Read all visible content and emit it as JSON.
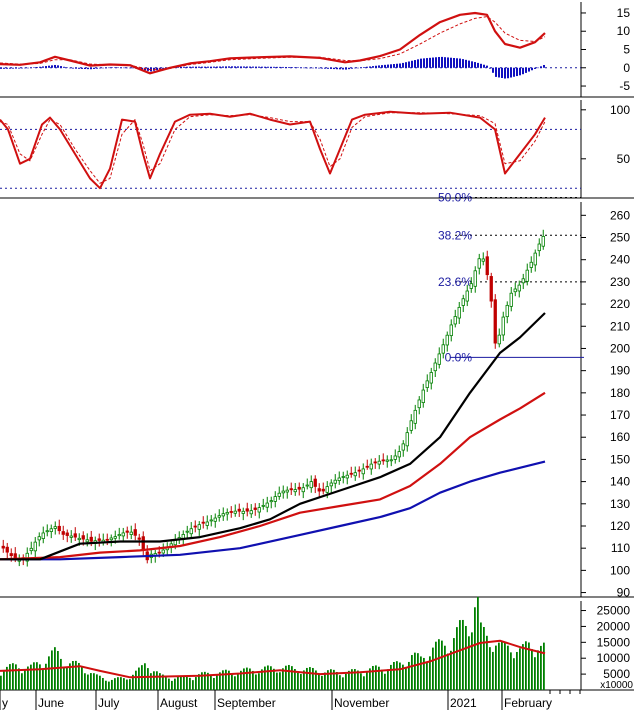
{
  "chart_data": {
    "type": "stock-technical-chart",
    "x_axis": {
      "month_labels": [
        "y",
        "June",
        "July",
        "August",
        "September",
        "November",
        "2021",
        "February"
      ]
    },
    "macd_panel": {
      "y_ticks": [
        15,
        10,
        5,
        0,
        -5
      ],
      "y_tick_labels": [
        "15",
        "10",
        "5",
        "0",
        "-5"
      ],
      "ylim": [
        -8,
        18
      ],
      "zero_line": 0,
      "macd_line": [
        [
          0,
          1
        ],
        [
          20,
          0.8
        ],
        [
          40,
          1.5
        ],
        [
          55,
          3
        ],
        [
          70,
          2
        ],
        [
          90,
          0.6
        ],
        [
          110,
          0.9
        ],
        [
          130,
          0.7
        ],
        [
          150,
          -1.5
        ],
        [
          170,
          0
        ],
        [
          190,
          1.2
        ],
        [
          210,
          1.8
        ],
        [
          230,
          2.6
        ],
        [
          260,
          2.9
        ],
        [
          290,
          3.1
        ],
        [
          320,
          2.7
        ],
        [
          345,
          1.5
        ],
        [
          360,
          2
        ],
        [
          380,
          3.2
        ],
        [
          400,
          5
        ],
        [
          420,
          9
        ],
        [
          440,
          12.5
        ],
        [
          460,
          14.5
        ],
        [
          475,
          15
        ],
        [
          487,
          14.5
        ],
        [
          495,
          10
        ],
        [
          505,
          6.5
        ],
        [
          520,
          5.5
        ],
        [
          535,
          7
        ],
        [
          545,
          9.5
        ]
      ],
      "signal_line": [
        [
          0,
          1.3
        ],
        [
          20,
          1
        ],
        [
          40,
          1.2
        ],
        [
          55,
          2.2
        ],
        [
          70,
          2.2
        ],
        [
          90,
          1
        ],
        [
          110,
          0.8
        ],
        [
          130,
          0.7
        ],
        [
          150,
          -0.5
        ],
        [
          170,
          -0.2
        ],
        [
          190,
          0.9
        ],
        [
          210,
          1.5
        ],
        [
          230,
          2.2
        ],
        [
          260,
          2.6
        ],
        [
          290,
          2.9
        ],
        [
          320,
          2.9
        ],
        [
          345,
          2
        ],
        [
          360,
          1.9
        ],
        [
          380,
          2.5
        ],
        [
          400,
          3.8
        ],
        [
          420,
          6.5
        ],
        [
          440,
          9.5
        ],
        [
          460,
          12
        ],
        [
          475,
          13.5
        ],
        [
          487,
          14
        ],
        [
          495,
          12.5
        ],
        [
          505,
          9.5
        ],
        [
          520,
          7.5
        ],
        [
          535,
          7.2
        ],
        [
          545,
          8.5
        ]
      ],
      "histogram": [
        [
          0,
          -0.3
        ],
        [
          20,
          -0.2
        ],
        [
          40,
          0.3
        ],
        [
          55,
          0.8
        ],
        [
          70,
          -0.2
        ],
        [
          90,
          -0.4
        ],
        [
          110,
          0.1
        ],
        [
          130,
          0
        ],
        [
          150,
          -1
        ],
        [
          170,
          0.2
        ],
        [
          190,
          0.3
        ],
        [
          210,
          0.3
        ],
        [
          230,
          0.4
        ],
        [
          260,
          0.3
        ],
        [
          290,
          0.2
        ],
        [
          320,
          -0.2
        ],
        [
          345,
          -0.5
        ],
        [
          360,
          0.1
        ],
        [
          380,
          0.7
        ],
        [
          400,
          1.2
        ],
        [
          420,
          2.5
        ],
        [
          440,
          3
        ],
        [
          460,
          2.5
        ],
        [
          475,
          1.5
        ],
        [
          487,
          0.5
        ],
        [
          495,
          -2.5
        ],
        [
          505,
          -3
        ],
        [
          520,
          -2
        ],
        [
          535,
          -0.2
        ],
        [
          545,
          1
        ]
      ]
    },
    "stochastic_panel": {
      "y_ticks": [
        100,
        50
      ],
      "y_tick_labels": [
        "100",
        "50"
      ],
      "ylim": [
        10,
        110
      ],
      "reference_lines": [
        80,
        20
      ],
      "k_line": [
        [
          0,
          90
        ],
        [
          8,
          80
        ],
        [
          20,
          45
        ],
        [
          30,
          50
        ],
        [
          42,
          85
        ],
        [
          50,
          92
        ],
        [
          60,
          80
        ],
        [
          75,
          55
        ],
        [
          90,
          30
        ],
        [
          100,
          20
        ],
        [
          110,
          40
        ],
        [
          122,
          90
        ],
        [
          135,
          88
        ],
        [
          143,
          55
        ],
        [
          150,
          30
        ],
        [
          160,
          55
        ],
        [
          175,
          88
        ],
        [
          190,
          95
        ],
        [
          210,
          96
        ],
        [
          230,
          93
        ],
        [
          250,
          96
        ],
        [
          270,
          90
        ],
        [
          290,
          85
        ],
        [
          310,
          88
        ],
        [
          320,
          60
        ],
        [
          330,
          35
        ],
        [
          340,
          60
        ],
        [
          352,
          90
        ],
        [
          365,
          95
        ],
        [
          390,
          98
        ],
        [
          420,
          96
        ],
        [
          450,
          97
        ],
        [
          480,
          92
        ],
        [
          495,
          80
        ],
        [
          505,
          35
        ],
        [
          520,
          55
        ],
        [
          535,
          75
        ],
        [
          545,
          92
        ]
      ],
      "d_line": [
        [
          0,
          88
        ],
        [
          8,
          85
        ],
        [
          20,
          55
        ],
        [
          30,
          48
        ],
        [
          42,
          75
        ],
        [
          50,
          90
        ],
        [
          60,
          85
        ],
        [
          75,
          60
        ],
        [
          90,
          38
        ],
        [
          100,
          25
        ],
        [
          110,
          30
        ],
        [
          122,
          75
        ],
        [
          135,
          90
        ],
        [
          143,
          65
        ],
        [
          150,
          38
        ],
        [
          160,
          45
        ],
        [
          175,
          80
        ],
        [
          190,
          93
        ],
        [
          210,
          95
        ],
        [
          230,
          94
        ],
        [
          250,
          95
        ],
        [
          270,
          92
        ],
        [
          290,
          88
        ],
        [
          310,
          88
        ],
        [
          320,
          70
        ],
        [
          330,
          42
        ],
        [
          340,
          50
        ],
        [
          352,
          82
        ],
        [
          365,
          93
        ],
        [
          390,
          97
        ],
        [
          420,
          97
        ],
        [
          450,
          96
        ],
        [
          480,
          94
        ],
        [
          495,
          86
        ],
        [
          505,
          45
        ],
        [
          520,
          48
        ],
        [
          535,
          68
        ],
        [
          545,
          88
        ]
      ]
    },
    "price_panel": {
      "y_ticks": [
        260,
        250,
        240,
        230,
        220,
        210,
        200,
        190,
        180,
        170,
        160,
        150,
        140,
        130,
        120,
        110,
        100,
        90
      ],
      "y_tick_labels": [
        "260",
        "250",
        "240",
        "230",
        "220",
        "210",
        "200",
        "190",
        "180",
        "170",
        "160",
        "150",
        "140",
        "130",
        "120",
        "110",
        "100",
        "90"
      ],
      "ylim": [
        88,
        266
      ],
      "close": [
        [
          0,
          111
        ],
        [
          10,
          108
        ],
        [
          20,
          105
        ],
        [
          30,
          109
        ],
        [
          40,
          115
        ],
        [
          50,
          119
        ],
        [
          55,
          121
        ],
        [
          60,
          118
        ],
        [
          70,
          116
        ],
        [
          80,
          113
        ],
        [
          90,
          112
        ],
        [
          100,
          114
        ],
        [
          110,
          116
        ],
        [
          120,
          117
        ],
        [
          130,
          116
        ],
        [
          140,
          112
        ],
        [
          145,
          104
        ],
        [
          150,
          108
        ],
        [
          160,
          110
        ],
        [
          170,
          112
        ],
        [
          180,
          114
        ],
        [
          190,
          118
        ],
        [
          200,
          122
        ],
        [
          210,
          124
        ],
        [
          220,
          125
        ],
        [
          230,
          125
        ],
        [
          240,
          126
        ],
        [
          250,
          128
        ],
        [
          260,
          130
        ],
        [
          270,
          131
        ],
        [
          280,
          134
        ],
        [
          290,
          136
        ],
        [
          300,
          138
        ],
        [
          310,
          141
        ],
        [
          320,
          134
        ],
        [
          330,
          138
        ],
        [
          340,
          142
        ],
        [
          350,
          145
        ],
        [
          360,
          146
        ],
        [
          370,
          147
        ],
        [
          380,
          148
        ],
        [
          390,
          150
        ],
        [
          400,
          156
        ],
        [
          410,
          168
        ],
        [
          420,
          178
        ],
        [
          430,
          188
        ],
        [
          440,
          200
        ],
        [
          450,
          212
        ],
        [
          460,
          221
        ],
        [
          470,
          228
        ],
        [
          480,
          242
        ],
        [
          485,
          236
        ],
        [
          490,
          222
        ],
        [
          495,
          199
        ],
        [
          500,
          213
        ],
        [
          510,
          225
        ],
        [
          520,
          228
        ],
        [
          530,
          238
        ],
        [
          540,
          250
        ],
        [
          545,
          254
        ]
      ],
      "ma_black": [
        [
          0,
          105
        ],
        [
          40,
          105
        ],
        [
          80,
          112
        ],
        [
          120,
          113
        ],
        [
          160,
          113
        ],
        [
          200,
          115
        ],
        [
          240,
          119
        ],
        [
          270,
          123
        ],
        [
          300,
          130
        ],
        [
          340,
          136
        ],
        [
          380,
          142
        ],
        [
          410,
          148
        ],
        [
          440,
          160
        ],
        [
          470,
          180
        ],
        [
          500,
          198
        ],
        [
          520,
          205
        ],
        [
          545,
          216
        ]
      ],
      "ma_red": [
        [
          0,
          105
        ],
        [
          60,
          106
        ],
        [
          100,
          108
        ],
        [
          140,
          109
        ],
        [
          180,
          111
        ],
        [
          220,
          115
        ],
        [
          260,
          120
        ],
        [
          300,
          126
        ],
        [
          340,
          129
        ],
        [
          380,
          132
        ],
        [
          410,
          138
        ],
        [
          440,
          148
        ],
        [
          470,
          160
        ],
        [
          500,
          168
        ],
        [
          520,
          173
        ],
        [
          545,
          180
        ]
      ],
      "ma_blue": [
        [
          0,
          105
        ],
        [
          60,
          105
        ],
        [
          120,
          106
        ],
        [
          180,
          107
        ],
        [
          240,
          110
        ],
        [
          300,
          116
        ],
        [
          340,
          120
        ],
        [
          380,
          124
        ],
        [
          410,
          128
        ],
        [
          440,
          135
        ],
        [
          470,
          140
        ],
        [
          500,
          144
        ],
        [
          545,
          149
        ]
      ],
      "fibonacci": [
        {
          "label": "50.0%",
          "value": 268
        },
        {
          "label": "38.2%",
          "value": 251
        },
        {
          "label": "23.6%",
          "value": 230
        },
        {
          "label": "0.0%",
          "value": 196
        }
      ]
    },
    "volume_panel": {
      "y_ticks": [
        25000,
        20000,
        15000,
        10000,
        5000
      ],
      "y_tick_labels": [
        "25000",
        "20000",
        "15000",
        "10000",
        "5000"
      ],
      "unit_label": "x10000",
      "ylim": [
        0,
        28000
      ],
      "volume": [
        [
          0,
          6000
        ],
        [
          15,
          7000
        ],
        [
          30,
          6500
        ],
        [
          45,
          9000
        ],
        [
          55,
          11000
        ],
        [
          65,
          8000
        ],
        [
          80,
          7000
        ],
        [
          95,
          4000
        ],
        [
          110,
          3000
        ],
        [
          125,
          3500
        ],
        [
          140,
          6000
        ],
        [
          145,
          8000
        ],
        [
          160,
          4000
        ],
        [
          180,
          3500
        ],
        [
          200,
          4500
        ],
        [
          220,
          5000
        ],
        [
          240,
          5500
        ],
        [
          260,
          6000
        ],
        [
          280,
          6500
        ],
        [
          300,
          6000
        ],
        [
          320,
          5500
        ],
        [
          340,
          5000
        ],
        [
          360,
          5500
        ],
        [
          380,
          6500
        ],
        [
          400,
          7500
        ],
        [
          410,
          10000
        ],
        [
          420,
          9000
        ],
        [
          430,
          12000
        ],
        [
          440,
          13000
        ],
        [
          450,
          14000
        ],
        [
          460,
          18000
        ],
        [
          470,
          20000
        ],
        [
          476,
          27000
        ],
        [
          480,
          17000
        ],
        [
          490,
          15000
        ],
        [
          500,
          12000
        ],
        [
          510,
          13000
        ],
        [
          520,
          11000
        ],
        [
          530,
          14000
        ],
        [
          540,
          12000
        ]
      ],
      "volume_ma": [
        [
          0,
          6000
        ],
        [
          40,
          6500
        ],
        [
          80,
          7500
        ],
        [
          100,
          6000
        ],
        [
          130,
          4000
        ],
        [
          160,
          4200
        ],
        [
          200,
          4500
        ],
        [
          240,
          5200
        ],
        [
          280,
          6200
        ],
        [
          320,
          5000
        ],
        [
          360,
          5600
        ],
        [
          400,
          6500
        ],
        [
          430,
          9000
        ],
        [
          460,
          12500
        ],
        [
          480,
          14800
        ],
        [
          500,
          15500
        ],
        [
          520,
          13500
        ],
        [
          545,
          11500
        ]
      ]
    }
  }
}
